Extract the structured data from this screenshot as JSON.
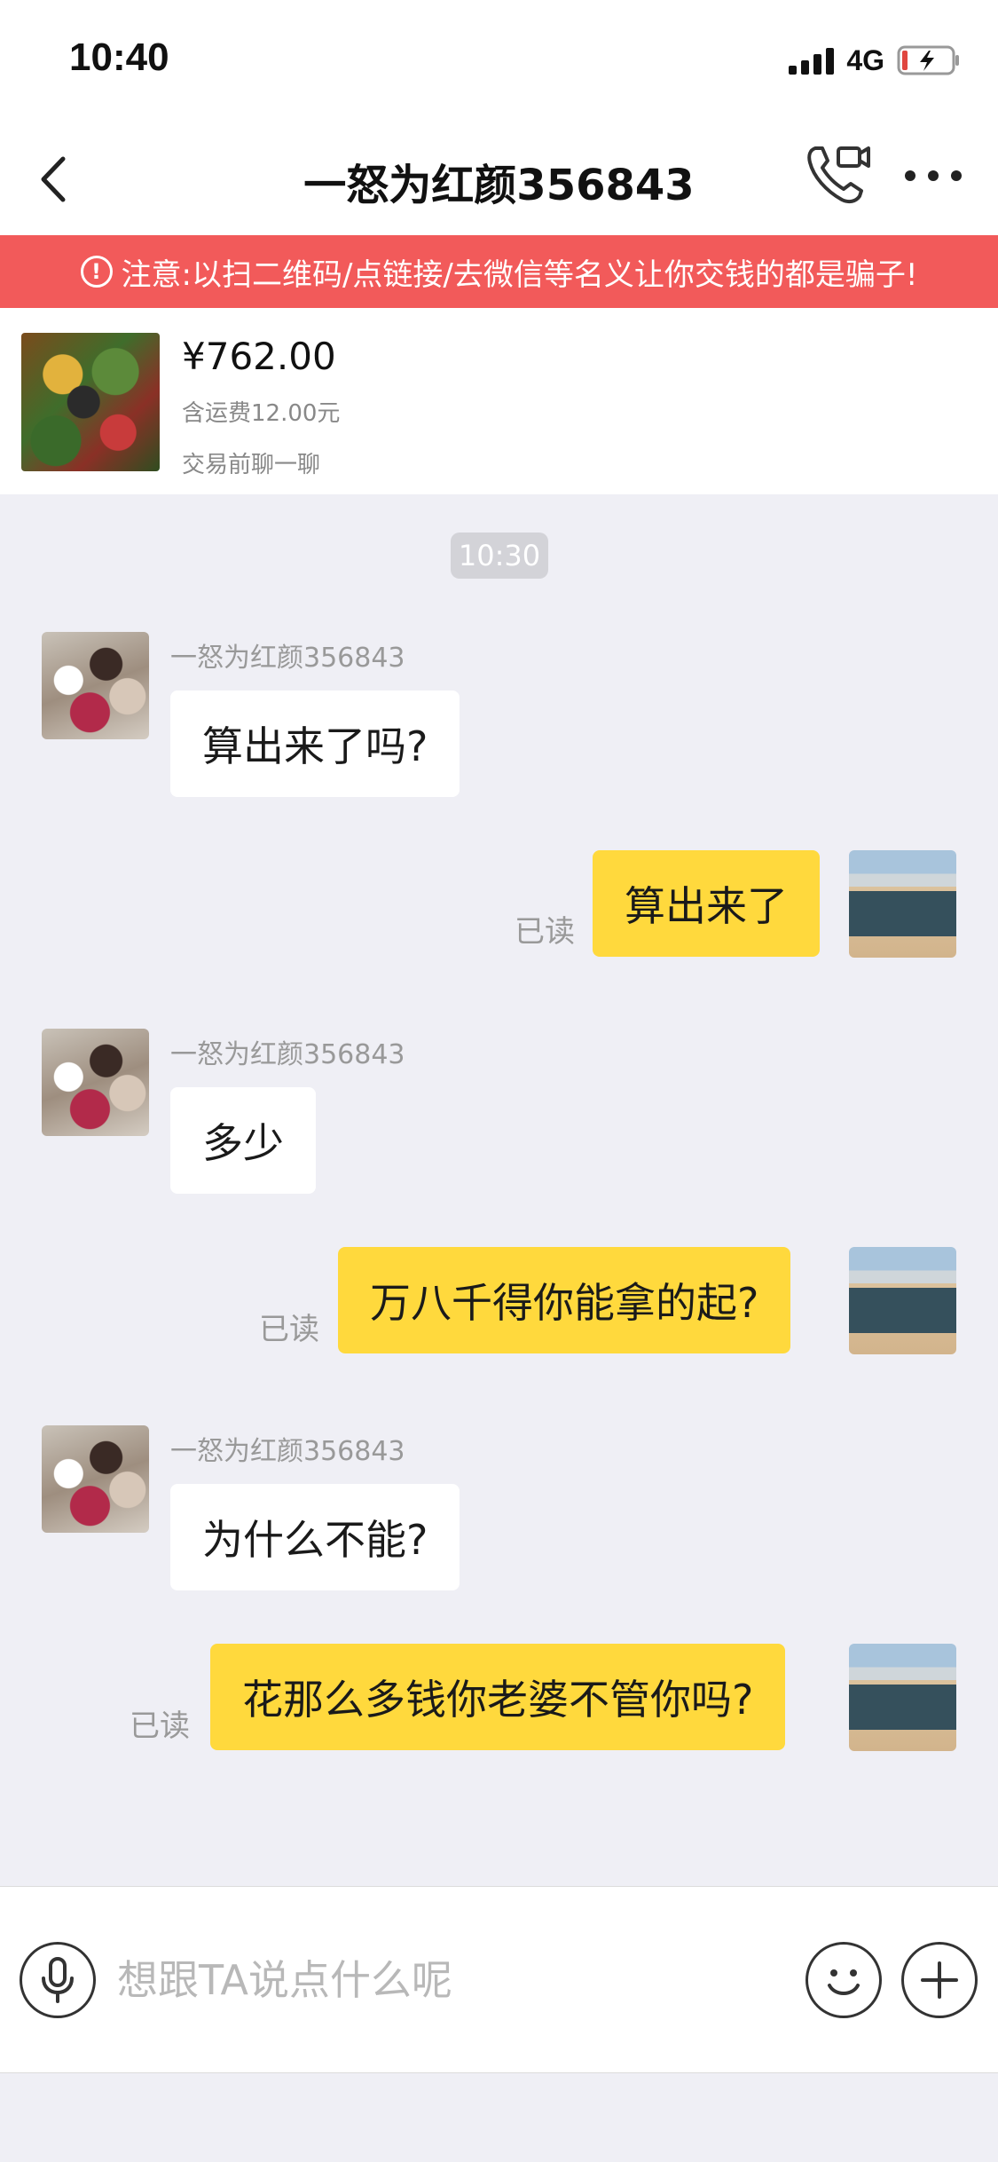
{
  "status_bar": {
    "time": "10:40",
    "network": "4G"
  },
  "header": {
    "title": "一怒为红颜356843",
    "back_icon": "chevron-left-icon",
    "call_icon": "phone-video-icon",
    "more_icon": "more-dots-icon"
  },
  "warning": {
    "icon": "!",
    "text": "注意:以扫二维码/点链接/去微信等名义让你交钱的都是骗子!",
    "color": "#f25a5a"
  },
  "product": {
    "price": "¥762.00",
    "shipping": "含运费12.00元",
    "note": "交易前聊一聊"
  },
  "chat": {
    "timestamp": "10:30",
    "read_label": "已读",
    "sender_name": "一怒为红颜356843",
    "messages": [
      {
        "from": "other",
        "text": "算出来了吗?"
      },
      {
        "from": "self",
        "text": "算出来了"
      },
      {
        "from": "other",
        "text": "多少"
      },
      {
        "from": "self",
        "text": "万八千得你能拿的起?"
      },
      {
        "from": "other",
        "text": "为什么不能?"
      },
      {
        "from": "self",
        "text": "花那么多钱你老婆不管你吗?"
      }
    ]
  },
  "input_bar": {
    "placeholder": "想跟TA说点什么呢",
    "value": "",
    "accent": "#ffd93d"
  }
}
